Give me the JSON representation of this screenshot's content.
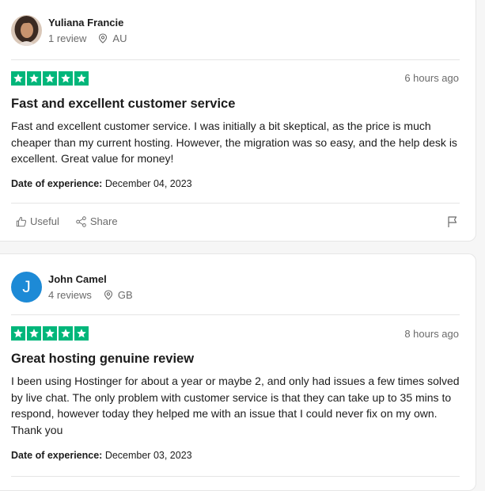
{
  "reviews": [
    {
      "reviewer": "Yuliana Francie",
      "review_count": "1 review",
      "country": "AU",
      "rating": 5,
      "time_ago": "6 hours ago",
      "title": "Fast and excellent customer service",
      "body": "Fast and excellent customer service. I was initially a bit skeptical, as the price is much cheaper than my current hosting. However, the migration was so easy, and the help desk is excellent. Great value for money!",
      "experience_label": "Date of experience:",
      "experience_date": "December 04, 2023",
      "useful_label": "Useful",
      "share_label": "Share"
    },
    {
      "reviewer": "John Camel",
      "avatar_letter": "J",
      "review_count": "4 reviews",
      "country": "GB",
      "rating": 5,
      "time_ago": "8 hours ago",
      "title": "Great hosting genuine review",
      "body": "I been using Hostinger for about a year or maybe 2, and only had issues a few times solved by live chat. The only problem with customer service is that they can take up to 35 mins to respond, however today they helped me with an issue that I could never fix on my own. Thank you",
      "experience_label": "Date of experience:",
      "experience_date": "December 03, 2023"
    }
  ],
  "colors": {
    "star_green": "#00b67a",
    "avatar_blue": "#1d8ad6"
  },
  "icons": [
    "location-pin-icon",
    "thumbs-up-icon",
    "share-icon",
    "flag-icon",
    "star-icon"
  ]
}
